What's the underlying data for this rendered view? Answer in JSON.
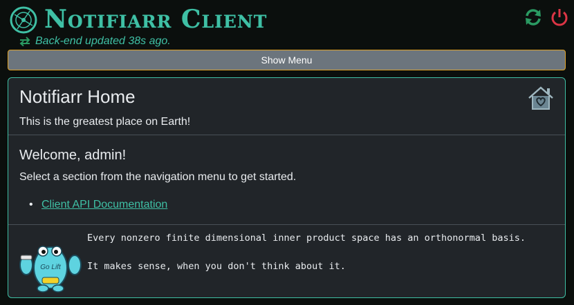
{
  "header": {
    "app_title": "Notifiarr Client",
    "status_text": "Back-end updated 38s ago.",
    "icons": {
      "logo": "notifiarr-logo-icon",
      "status": "sync-arrows-icon",
      "refresh": "refresh-icon",
      "power": "power-icon"
    },
    "colors": {
      "accent": "#3fc0a5",
      "refresh": "#2a9a62",
      "power": "#dc3545"
    }
  },
  "menu": {
    "show_menu_label": "Show Menu",
    "border_color": "#e0a329"
  },
  "home_card": {
    "title": "Notifiarr Home",
    "subtitle": "This is the greatest place on Earth!",
    "icon": "home-heart-icon",
    "welcome": "Welcome, admin!",
    "instructions": "Select a section from the navigation menu to get started.",
    "links": [
      {
        "label": "Client API Documentation"
      }
    ],
    "footer": {
      "image": "gopher-lifting-weights-icon",
      "badge_text": "Go Lift",
      "quote_line1": "Every nonzero finite dimensional inner product space has an orthonormal basis.",
      "quote_line2": "It makes sense, when you don't think about it."
    }
  }
}
